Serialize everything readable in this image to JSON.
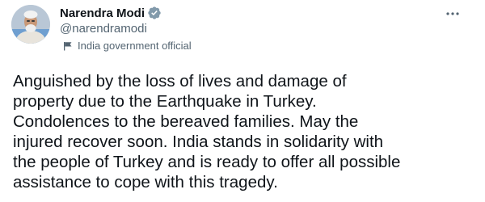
{
  "author": {
    "display_name": "Narendra Modi",
    "handle": "@narendramodi",
    "verified": true,
    "verified_color": "#829aab",
    "affiliation_label": "India government official"
  },
  "tweet": {
    "lines": [
      "Anguished by the loss of lives and damage of",
      "property due to the Earthquake in Turkey.",
      "Condolences to the bereaved families. May the",
      "injured recover soon. India stands in solidarity with",
      "the people of Turkey and is ready to offer all possible",
      "assistance to cope with this tragedy."
    ]
  },
  "icons": {
    "avatar": "profile-photo",
    "verified": "verified-badge-icon",
    "affiliation": "flag-icon",
    "more": "more-options-icon"
  },
  "colors": {
    "text_primary": "#0f1419",
    "text_secondary": "#536471",
    "background": "#ffffff"
  }
}
